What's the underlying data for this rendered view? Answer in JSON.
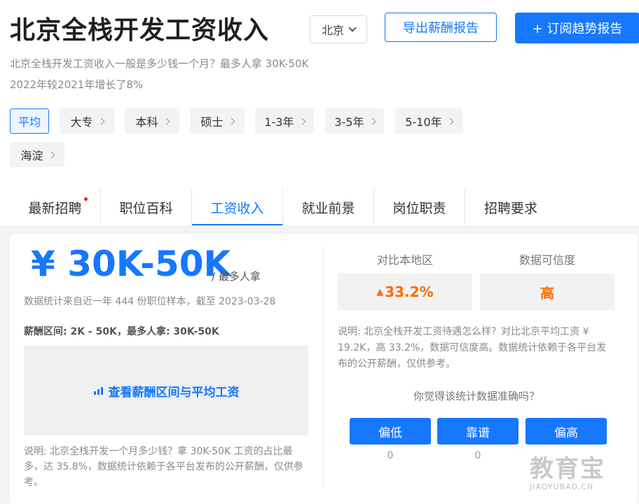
{
  "header": {
    "title": "北京全栈开发工资收入",
    "city_select": "北京",
    "export_button": "导出薪酬报告",
    "subscribe_button": "+ 订阅趋势报告",
    "subtitle1": "北京全栈开发工资收入一般是多少钱一个月？最多人拿 30K-50K",
    "subtitle2": "2022年较2021年增长了8%"
  },
  "filters": [
    "平均",
    "大专",
    "本科",
    "硕士",
    "1-3年",
    "3-5年",
    "5-10年",
    "海淀"
  ],
  "tabs": [
    "最新招聘",
    "职位百科",
    "工资收入",
    "就业前景",
    "岗位职责",
    "招聘要求"
  ],
  "salary": {
    "value": "¥ 30K-50K",
    "suffix": "/ 最多人拿",
    "stats": "数据统计来自近一年 444 份职位样本，截至 2023-03-28",
    "range": "薪酬区间: 2K - 50K，最多人拿: 30K-50K",
    "view_link": "查看薪酬区间与平均工资",
    "note": "说明: 北京全栈开发一个月多少钱？拿 30K-50K 工资的占比最多，达 35.8%，数据统计依赖于各平台发布的公开薪酬，仅供参考。"
  },
  "compare": {
    "region_label": "对比本地区",
    "region_value": "33.2%",
    "trust_label": "数据可信度",
    "trust_value": "高",
    "note": "说明: 北京全栈开发工资待遇怎么样？对比北京平均工资 ¥ 19.2K，高 33.2%，数据可信度高。数据统计依赖于各平台发布的公开薪酬，仅供参考。",
    "question": "你觉得该统计数据准确吗？",
    "votes": [
      {
        "label": "偏低",
        "count": "0"
      },
      {
        "label": "靠谱",
        "count": "0"
      },
      {
        "label": "偏高",
        "count": ""
      }
    ]
  },
  "watermark": {
    "cn": "教育宝",
    "en": "JIAOYUBAO.CN"
  },
  "colors": {
    "accent": "#1677ff",
    "up": "#ff6a00"
  }
}
